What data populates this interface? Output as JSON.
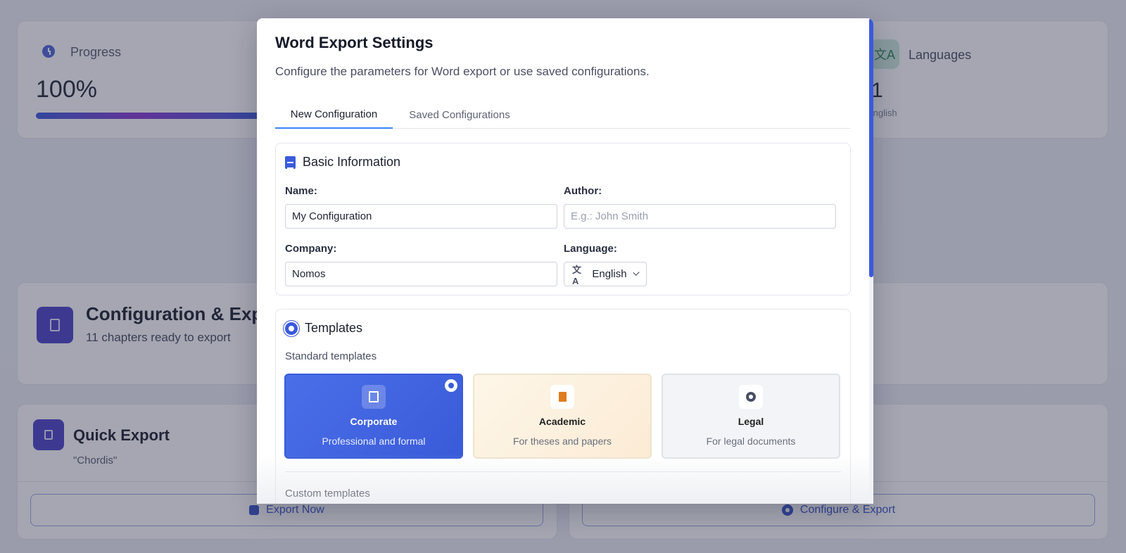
{
  "background": {
    "progress": {
      "label": "Progress",
      "value": "100%",
      "fill": 1.0
    },
    "languages": {
      "label": "Languages",
      "count": "1",
      "sub": "English"
    },
    "config_export": {
      "title": "Configuration & Export",
      "subtitle": "11 chapters ready to export"
    },
    "quick_export": {
      "title": "Quick Export",
      "subtitle": "\"Chordis\"",
      "button": "Export Now"
    },
    "configure_export_button": "Configure & Export"
  },
  "modal": {
    "title": "Word Export Settings",
    "description": "Configure the parameters for Word export or use saved configurations.",
    "tabs": [
      {
        "label": "New Configuration",
        "active": true
      },
      {
        "label": "Saved Configurations",
        "active": false
      }
    ],
    "basic": {
      "heading": "Basic Information",
      "name_label": "Name:",
      "name_value": "My Configuration",
      "author_label": "Author:",
      "author_placeholder": "E.g.: John Smith",
      "company_label": "Company:",
      "company_value": "Nomos",
      "language_label": "Language:",
      "language_value": "English"
    },
    "templates": {
      "heading": "Templates",
      "standard_label": "Standard templates",
      "items": [
        {
          "name": "Corporate",
          "desc": "Professional and formal",
          "selected": true
        },
        {
          "name": "Academic",
          "desc": "For theses and papers",
          "selected": false
        },
        {
          "name": "Legal",
          "desc": "For legal documents",
          "selected": false
        }
      ],
      "custom_label": "Custom templates"
    }
  },
  "colors": {
    "accent": "#3b5bdb",
    "brand_purple": "#4d44c9"
  }
}
